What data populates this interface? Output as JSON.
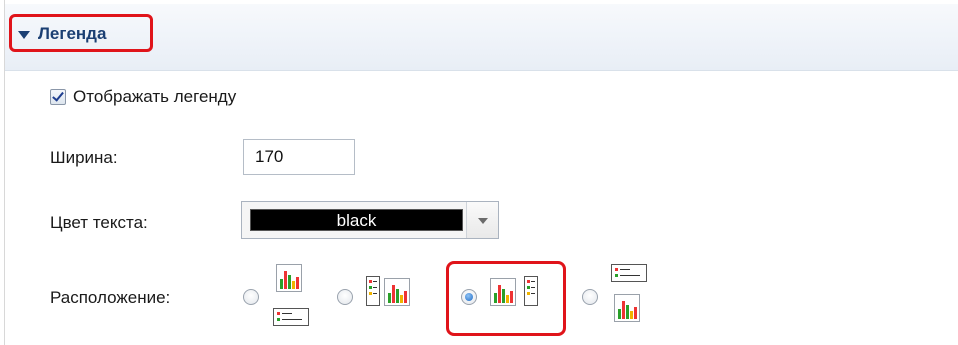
{
  "section": {
    "title": "Легенда",
    "expanded": true
  },
  "show_legend": {
    "label": "Отображать легенду",
    "checked": true
  },
  "width": {
    "label": "Ширина:",
    "value": "170"
  },
  "text_color": {
    "label": "Цвет текста:",
    "value": "black",
    "swatch": "#000000"
  },
  "position": {
    "label": "Расположение:",
    "options": [
      {
        "id": "legend-bottom",
        "icon": "chart-with-legend-below-icon",
        "selected": false
      },
      {
        "id": "legend-left",
        "icon": "chart-with-legend-left-icon",
        "selected": false
      },
      {
        "id": "legend-right",
        "icon": "chart-with-legend-right-icon",
        "selected": true
      },
      {
        "id": "legend-top",
        "icon": "chart-with-legend-above-icon",
        "selected": false
      }
    ]
  },
  "colors": {
    "highlight": "#e0141a",
    "header_text": "#1b3f73"
  }
}
